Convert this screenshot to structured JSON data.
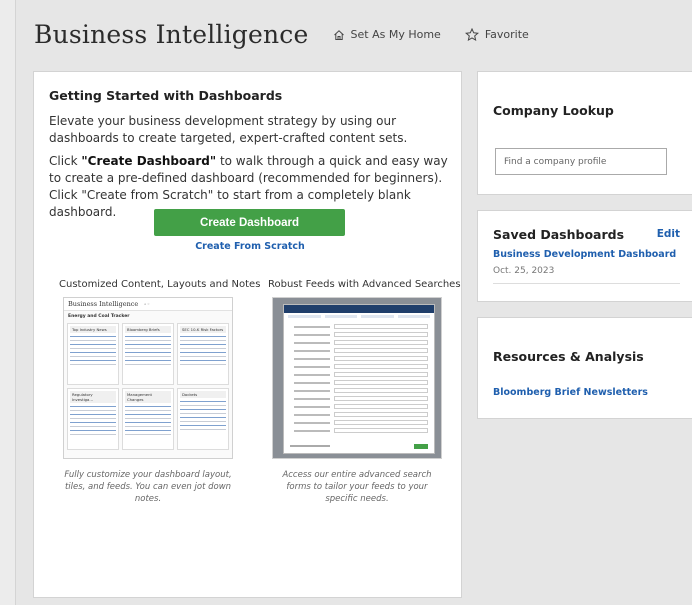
{
  "header": {
    "title": "Business Intelligence",
    "set_home_label": "Set As My Home",
    "favorite_label": "Favorite"
  },
  "getting_started": {
    "heading": "Getting Started with Dashboards",
    "intro": "Elevate your business development strategy by using our dashboards to create targeted, expert-crafted content sets.",
    "instructions_prefix": "Click ",
    "instructions_bold": "\"Create Dashboard\"",
    "instructions_rest": " to walk through a quick and easy way to create a pre-defined dashboard (recommended for beginners). Click \"Create from Scratch\" to start from a completely blank dashboard.",
    "create_button": "Create Dashboard",
    "scratch_link": "Create From Scratch",
    "feature1": {
      "caption": "Customized Content, Layouts and Notes",
      "note": "Fully customize your dashboard layout, tiles, and feeds. You can even jot down notes."
    },
    "feature2": {
      "caption": "Robust Feeds with Advanced Searches",
      "note": "Access our entire advanced search forms to tailor your feeds to your specific needs."
    }
  },
  "company_lookup": {
    "heading": "Company Lookup",
    "placeholder": "Find a company profile"
  },
  "saved_dashboards": {
    "heading": "Saved Dashboards",
    "edit_label": "Edit",
    "items": [
      {
        "name": "Business Development Dashboard",
        "date": "Oct. 25, 2023"
      }
    ]
  },
  "resources": {
    "heading": "Resources & Analysis",
    "links": [
      "Bloomberg Brief Newsletters"
    ]
  },
  "colors": {
    "accent_green": "#43a047",
    "link_blue": "#1f5fae"
  }
}
